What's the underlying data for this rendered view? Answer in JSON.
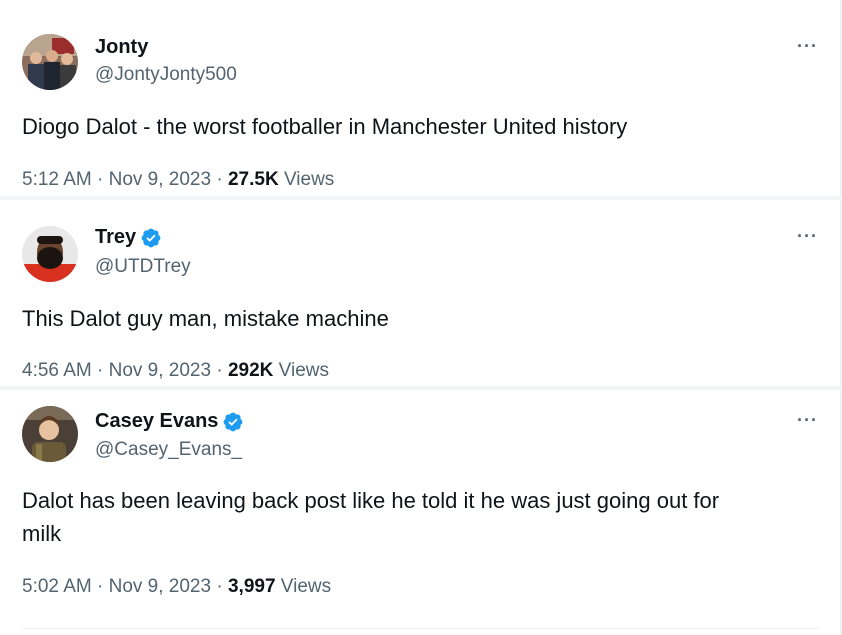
{
  "tweets": [
    {
      "name": "Jonty",
      "handle": "@JontyJonty500",
      "verified": false,
      "text": "Diogo Dalot - the worst footballer in Manchester United history",
      "time": "5:12 AM",
      "date": "Nov 9, 2023",
      "views": "27.5K",
      "views_label": "Views",
      "more": "···"
    },
    {
      "name": "Trey",
      "handle": "@UTDTrey",
      "verified": true,
      "text": "This Dalot guy man, mistake machine",
      "time": "4:56 AM",
      "date": "Nov 9, 2023",
      "views": "292K",
      "views_label": "Views",
      "more": "···"
    },
    {
      "name": "Casey Evans",
      "handle": "@Casey_Evans_",
      "verified": true,
      "text_line1": "Dalot has been leaving back post like he told it he was just going out for",
      "text_line2": "milk",
      "time": "5:02 AM",
      "date": "Nov 9, 2023",
      "views": "3,997",
      "views_label": "Views",
      "more": "···"
    }
  ],
  "separator": " · ",
  "colors": {
    "text": "#0f1419",
    "secondary": "#536471",
    "verified": "#1d9bf0"
  }
}
